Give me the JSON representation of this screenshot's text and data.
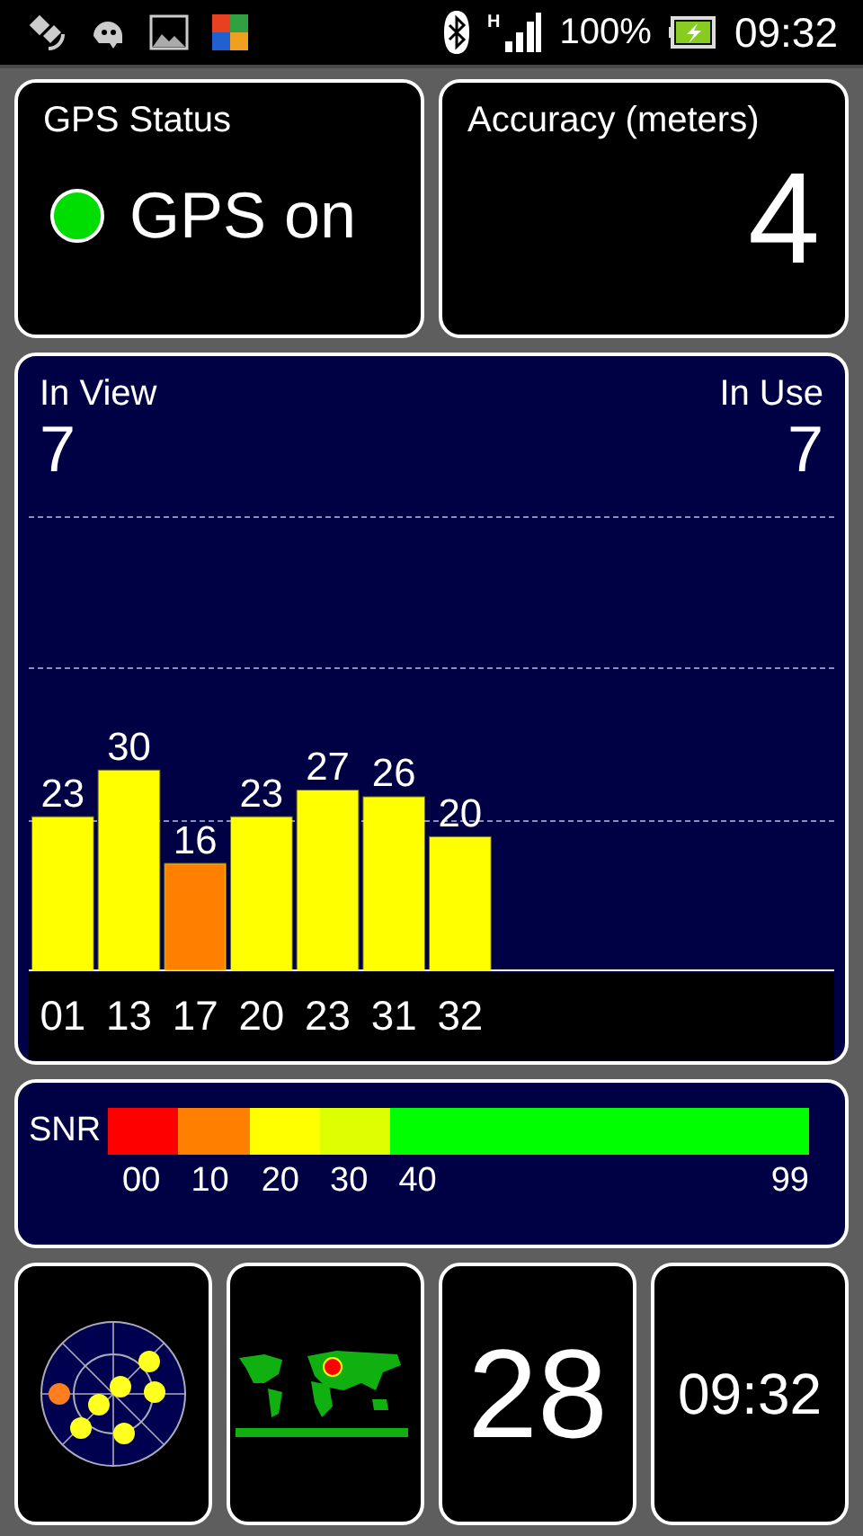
{
  "status_bar": {
    "network": "H",
    "battery": "100%",
    "time": "09:32"
  },
  "gps_status": {
    "title": "GPS Status",
    "label": "GPS on",
    "on": true
  },
  "accuracy": {
    "title": "Accuracy (meters)",
    "value": "4"
  },
  "satellites": {
    "in_view_label": "In View",
    "in_view": "7",
    "in_use_label": "In Use",
    "in_use": "7",
    "chart_data": {
      "type": "bar",
      "categories": [
        "01",
        "13",
        "17",
        "20",
        "23",
        "31",
        "32"
      ],
      "data_labels": true,
      "series": [
        {
          "color": "#ffff00",
          "values": [
            23,
            30,
            16,
            23,
            27,
            26,
            20
          ],
          "colors": [
            "#ffff00",
            "#ffff00",
            "#ff8000",
            "#ffff00",
            "#ffff00",
            "#ffff00",
            "#ffff00"
          ]
        }
      ]
    }
  },
  "snr_legend": {
    "label": "SNR",
    "end": "99",
    "segments": [
      {
        "from": "00",
        "color": "#ff0000"
      },
      {
        "from": "10",
        "color": "#ff8000"
      },
      {
        "from": "20",
        "color": "#ffff00"
      },
      {
        "from": "30",
        "color": "#ddff00"
      },
      {
        "from": "40",
        "color": "#00ff00"
      }
    ]
  },
  "tiles": [
    {
      "kind": "skyplot"
    },
    {
      "kind": "map"
    },
    {
      "kind": "number",
      "text": "28"
    },
    {
      "kind": "clock",
      "text": "09:32"
    }
  ]
}
